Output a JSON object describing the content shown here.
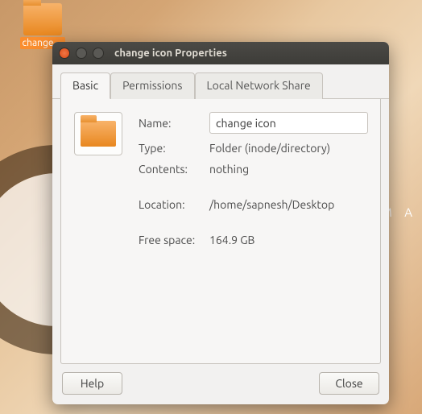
{
  "desktop": {
    "folder_label": "change…",
    "bg_text": "M A"
  },
  "window": {
    "title": "change icon Properties"
  },
  "tabs": {
    "basic": "Basic",
    "permissions": "Permissions",
    "localshare": "Local Network Share"
  },
  "basic": {
    "name_label": "Name:",
    "name_value": "change icon",
    "type_label": "Type:",
    "type_value": "Folder (inode/directory)",
    "contents_label": "Contents:",
    "contents_value": "nothing",
    "location_label": "Location:",
    "location_value": "/home/sapnesh/Desktop",
    "freespace_label": "Free space:",
    "freespace_value": "164.9 GB"
  },
  "buttons": {
    "help": "Help",
    "close": "Close"
  }
}
